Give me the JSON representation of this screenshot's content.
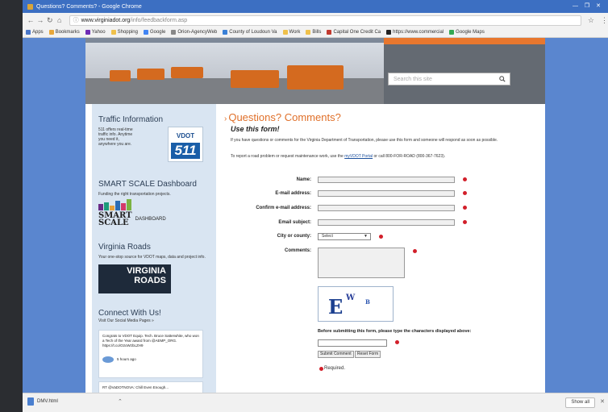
{
  "browser": {
    "window_title": "Questions? Comments? - Google Chrome",
    "url_host": "www.virginiadot.org",
    "url_path": "/info/feedbackform.asp",
    "bookmarks": [
      {
        "label": "Apps",
        "color": "#4a77c9"
      },
      {
        "label": "Bookmarks",
        "color": "#e7a73b"
      },
      {
        "label": "Yahoo",
        "color": "#6e2bb5"
      },
      {
        "label": "Shopping",
        "color": "#f0c14b"
      },
      {
        "label": "Google",
        "color": "#4285f4"
      },
      {
        "label": "Orion-AgencyWeb",
        "color": "#888888"
      },
      {
        "label": "County of Loudoun Va",
        "color": "#3a80d6"
      },
      {
        "label": "Work",
        "color": "#f0c14b"
      },
      {
        "label": "Bills",
        "color": "#f0c14b"
      },
      {
        "label": "Capital One Credit Ca",
        "color": "#c23a2f"
      },
      {
        "label": "https://www.commercial",
        "color": "#222222"
      },
      {
        "label": "Google Maps",
        "color": "#34a853"
      }
    ]
  },
  "site": {
    "search_placeholder": "Search this site"
  },
  "sidebar": {
    "traffic": {
      "title": "Traffic Information",
      "text": "511 offers real-time traffic info. Anytime you need it, anywhere you are.",
      "badge_top": "VDOT",
      "badge_num": "511"
    },
    "smart": {
      "title": "SMART SCALE Dashboard",
      "text": "Funding the right transportation projects.",
      "logo_line1": "SMART",
      "logo_line2": "SCALE",
      "logo_side": "DASHBOARD"
    },
    "roads": {
      "title": "Virginia Roads",
      "text": "Your one-stop source for VDOT maps, data and project info.",
      "logo_line1": "VIRGINIA",
      "logo_line2": "ROADS"
    },
    "connect": {
      "title": "Connect With Us!",
      "subtitle": "Visit Our Social Media Pages »",
      "tweet": "Congrats to VDOT Equip. Tech. Bruce Satterwhite, who won a Tech of the Year award from @AEMP_ORG. https://t.co/O2oWzbLZH9",
      "tweet_time": "5 hours ago",
      "tweet2": "RT @VaDOTNOVA: Chill Even Enough..."
    }
  },
  "form": {
    "title": "Questions? Comments?",
    "subtitle": "Use this form!",
    "intro1": "If you have questions or comments for the Virginia Department of Transportation, please use this form and someone will respond as soon as possible.",
    "intro2_pre": "To report a road problem or request maintenance work, use the",
    "intro2_link": "myVDOT Portal",
    "intro2_post": "or call 800-FOR-ROAD (800-367-7623).",
    "labels": {
      "name": "Name:",
      "email": "E-mail address:",
      "confirm_email": "Confirm e-mail address:",
      "subject": "Email subject:",
      "city": "City or county:",
      "comments": "Comments:"
    },
    "city_selected": "Select",
    "captcha": {
      "c1": "E",
      "c2": "W",
      "c3": "B"
    },
    "before_text": "Before submitting this form, please type the characters displayed above:",
    "submit_label": "Submit Comment",
    "reset_label": "Reset Form",
    "required_label": "Required."
  },
  "downloads": {
    "file": "DMV.html",
    "show_all": "Show all"
  }
}
